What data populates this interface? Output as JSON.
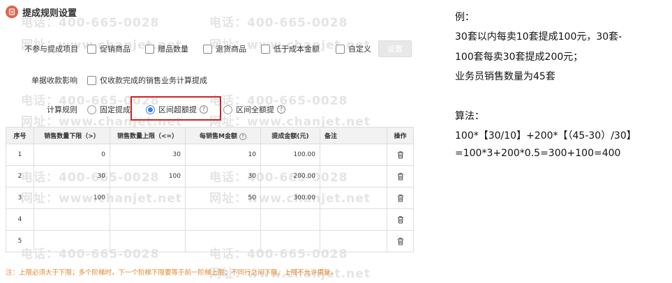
{
  "title": "提成规则设置",
  "exclude_row": {
    "label": "不参与提成项目",
    "options": [
      {
        "label": "促销商品",
        "checked": false
      },
      {
        "label": "赠品数量",
        "checked": false
      },
      {
        "label": "退货商品",
        "checked": false
      },
      {
        "label": "低于成本金额",
        "checked": false
      },
      {
        "label": "自定义",
        "checked": false
      }
    ],
    "settings_button": "设置"
  },
  "collection_row": {
    "label": "单据收款影响",
    "option": {
      "label": "仅收款完成的销售业务计算提成",
      "checked": false
    }
  },
  "calc_row": {
    "label": "计算规则",
    "options": [
      {
        "label": "固定提成",
        "selected": false
      },
      {
        "label": "区间超额提",
        "selected": true
      },
      {
        "label": "区间全额提",
        "selected": false
      }
    ]
  },
  "table": {
    "headers": {
      "seq": "序号",
      "lower": "销售数量下限（>）",
      "upper": "销售数量上限（<=）",
      "per_amount": "每销售M金额",
      "commission": "提成金额(元)",
      "remark": "备注",
      "action": "操作"
    },
    "rows": [
      {
        "seq": "1",
        "lower": "0",
        "upper": "30",
        "per": "10",
        "commission": "100.00",
        "remark": ""
      },
      {
        "seq": "2",
        "lower": "30",
        "upper": "100",
        "per": "30",
        "commission": "200.00",
        "remark": ""
      },
      {
        "seq": "3",
        "lower": "100",
        "upper": "",
        "per": "50",
        "commission": "300.00",
        "remark": ""
      },
      {
        "seq": "4",
        "lower": "",
        "upper": "",
        "per": "",
        "commission": "",
        "remark": ""
      },
      {
        "seq": "5",
        "lower": "",
        "upper": "",
        "per": "",
        "commission": "",
        "remark": ""
      }
    ]
  },
  "note": "注：上限必须大于下限；多个阶梯时，下一个阶梯下限要等于前一阶梯上限；不同行之间下限、上限不允许重复。",
  "example": {
    "line1": "例：",
    "line2": "30套以内每卖10套提成100元，30套-",
    "line3": "100套每卖30套提成200元；",
    "line4": "业务员销售数量为45套",
    "line5": "算法：",
    "line6": "100*【30/10】+200*【（45-30）/30】",
    "line7": "=100*3+200*0.5=300+100=400"
  },
  "watermark": {
    "phone": "电话：400-665-0028",
    "site": "网址：www.chanjet.net"
  },
  "colors": {
    "accent_blue": "#3b7de0",
    "highlight_red": "#d42020",
    "note_orange": "#e8842a",
    "title_icon": "#e0614b"
  }
}
